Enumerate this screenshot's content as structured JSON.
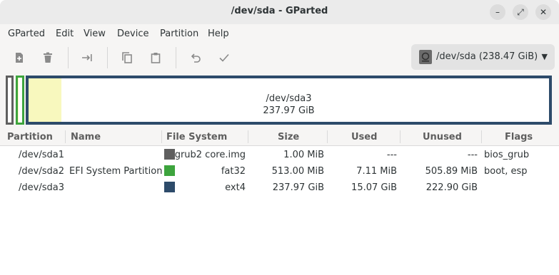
{
  "window": {
    "title": "/dev/sda - GParted"
  },
  "window_controls": {
    "minimize": "–",
    "maximize": "⤢",
    "close": "✕"
  },
  "menubar": [
    "GParted",
    "Edit",
    "View",
    "Device",
    "Partition",
    "Help"
  ],
  "toolbar": {
    "buttons": [
      "new",
      "delete",
      "resize-move",
      "copy",
      "paste",
      "undo",
      "apply"
    ]
  },
  "device": {
    "label": "/dev/sda (238.47 GiB)"
  },
  "map": {
    "partitions": [
      {
        "name": "/dev/sda1",
        "color": "#5f5f5f"
      },
      {
        "name": "/dev/sda2",
        "color": "#3da43d"
      },
      {
        "name": "/dev/sda3",
        "size": "237.97 GiB",
        "color": "#2d4b6a",
        "used_fraction": 0.063
      }
    ]
  },
  "columns": [
    "Partition",
    "Name",
    "File System",
    "Size",
    "Used",
    "Unused",
    "Flags"
  ],
  "rows": [
    {
      "partition": "/dev/sda1",
      "name": "",
      "fs": "grub2 core.img",
      "fs_color": "#5f5f5f",
      "size": "1.00 MiB",
      "used": "---",
      "unused": "---",
      "flags": "bios_grub"
    },
    {
      "partition": "/dev/sda2",
      "name": "EFI System Partition",
      "fs": "fat32",
      "fs_color": "#3da43d",
      "size": "513.00 MiB",
      "used": "7.11 MiB",
      "unused": "505.89 MiB",
      "flags": "boot, esp"
    },
    {
      "partition": "/dev/sda3",
      "name": "",
      "fs": "ext4",
      "fs_color": "#2d4b6a",
      "size": "237.97 GiB",
      "used": "15.07 GiB",
      "unused": "222.90 GiB",
      "flags": ""
    }
  ]
}
